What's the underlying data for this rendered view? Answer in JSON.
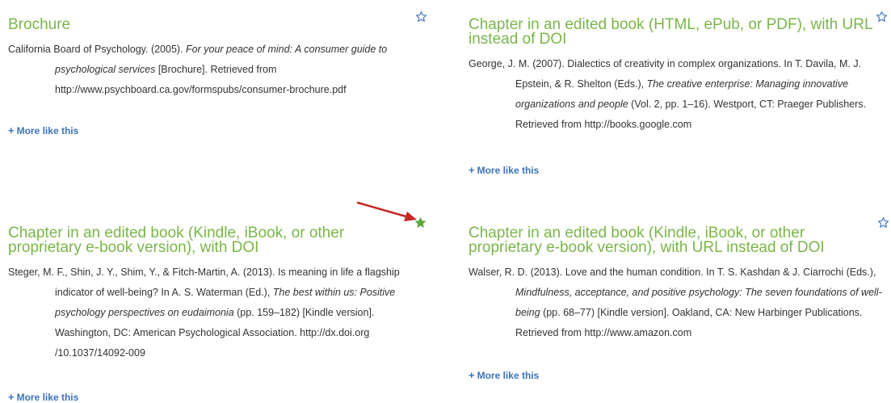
{
  "colors": {
    "title": "#7ab648",
    "link": "#3b73b9",
    "star_outline": "#3b73b9",
    "star_filled": "#5aa83a",
    "arrow": "#c62828"
  },
  "cards": [
    {
      "title": "Brochure",
      "citation": {
        "pre": "California Board of Psychology. (2005). ",
        "italic": "For your peace of mind: A consumer guide to psychological services",
        "post": " [Brochure]. Retrieved from http://www.psychboard.ca.gov/formspubs/consumer-brochure.pdf"
      },
      "more_label": "More like this",
      "starred": false
    },
    {
      "title": "Chapter in an edited book (HTML, ePub, or PDF), with URL instead of DOI",
      "citation": {
        "pre": "George, J. M. (2007). Dialectics of creativity in complex organizations. In T. Davila, M. J. Epstein, & R. Shelton (Eds.), ",
        "italic": "The creative enterprise: Managing innovative organizations and people",
        "post": " (Vol. 2, pp. 1–16). Westport, CT: Praeger Publishers. Retrieved from http://books.google.com"
      },
      "more_label": "More like this",
      "starred": false
    },
    {
      "title": "Chapter in an edited book (Kindle, iBook, or other proprietary e-book version), with DOI",
      "citation": {
        "pre": "Steger, M. F., Shin, J. Y., Shim, Y., & Fitch-Martin, A. (2013). Is meaning in life a flagship indicator of well-being? In A. S. Waterman (Ed.), ",
        "italic": "The best within us: Positive psychology perspectives on eudaimonia",
        "post": " (pp. 159–182) [Kindle version]. Washington, DC: American Psychological Association. http://dx.doi.org /10.1037/14092-009"
      },
      "more_label": "More like this",
      "starred": true
    },
    {
      "title": "Chapter in an edited book (Kindle, iBook, or other proprietary e-book version), with URL instead of DOI",
      "citation": {
        "pre": "Walser, R. D. (2013). Love and the human condition. In T. S. Kashdan & J. Ciarrochi (Eds.), ",
        "italic": "Mindfulness, acceptance, and positive psychology: The seven foundations of well-being",
        "post": " (pp. 68–77) [Kindle version]. Oakland, CA: New Harbinger Publications. Retrieved from http://www.amazon.com"
      },
      "more_label": "More like this",
      "starred": false
    }
  ]
}
